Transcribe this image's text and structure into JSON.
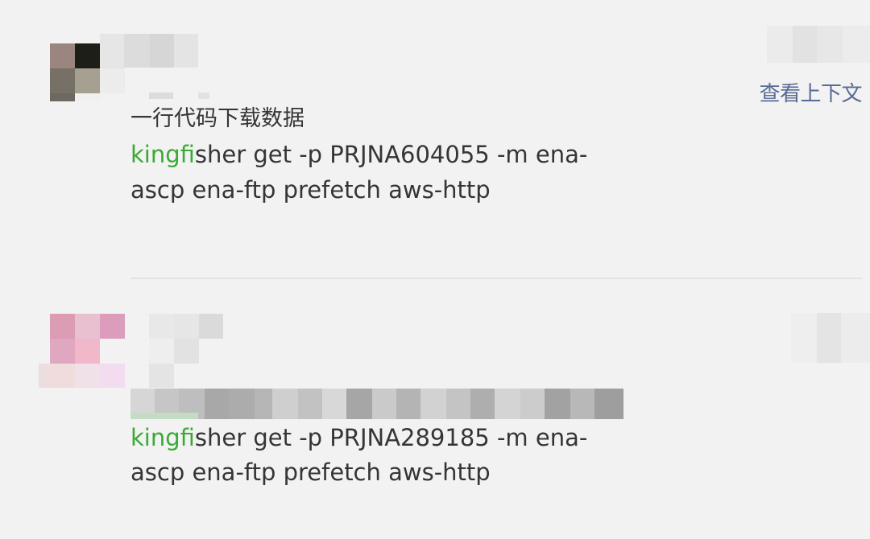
{
  "messages": [
    {
      "caption": "一行代码下载数据",
      "context_link": "查看上下文",
      "code_highlight": "kingfi",
      "code_line1_rest": "sher get -p PRJNA604055  -m ena-",
      "code_line2": "ascp ena-ftp prefetch aws-http"
    },
    {
      "code_highlight": "kingfi",
      "code_line1_rest": "sher  get -p PRJNA289185 -m ena-",
      "code_line2": "ascp ena-ftp prefetch aws-http"
    }
  ],
  "colors": {
    "background": "#f2f2f2",
    "link": "#576b95",
    "highlight": "#3aaa35",
    "text": "#353535"
  }
}
